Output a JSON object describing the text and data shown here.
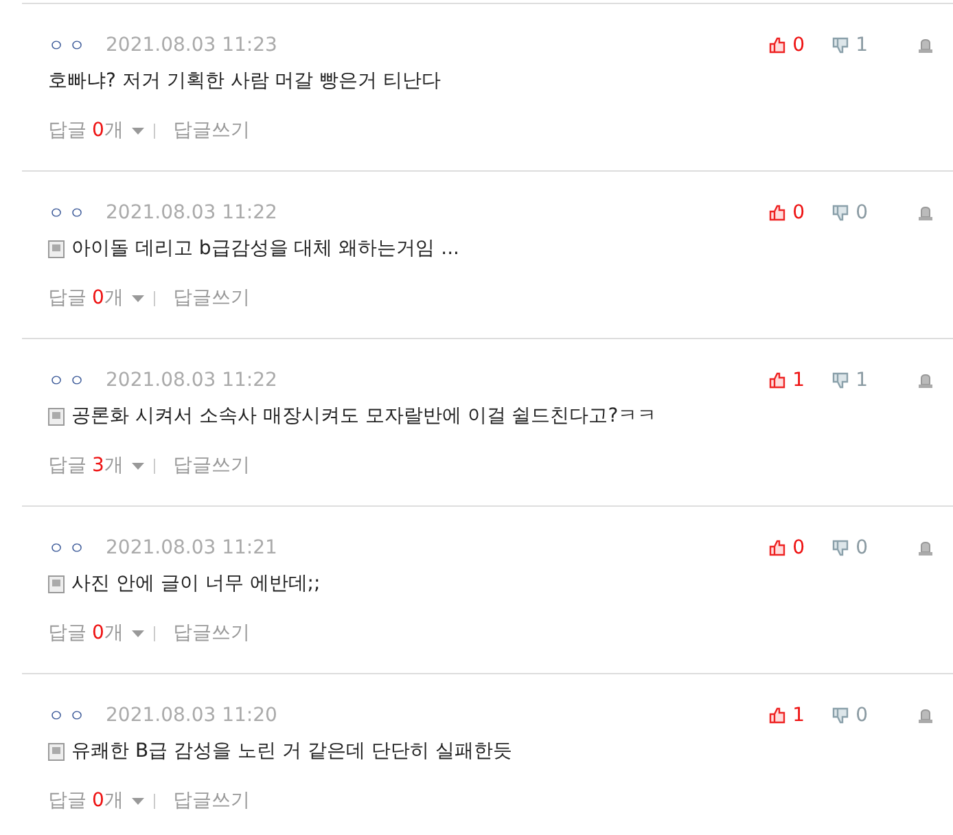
{
  "comments": [
    {
      "author": "ㅇㅇ",
      "date": "2021.08.03 11:23",
      "has_image": false,
      "text": "호빠냐? 저거 기획한 사람 머갈 빵은거 티난다",
      "likes": "0",
      "dislikes": "1",
      "reply_prefix": "답글",
      "reply_count": "0",
      "reply_suffix": "개",
      "write_reply": "답글쓰기"
    },
    {
      "author": "ㅇㅇ",
      "date": "2021.08.03 11:22",
      "has_image": true,
      "text": "아이돌 데리고 b급감성을 대체 왜하는거임 ...",
      "likes": "0",
      "dislikes": "0",
      "reply_prefix": "답글",
      "reply_count": "0",
      "reply_suffix": "개",
      "write_reply": "답글쓰기"
    },
    {
      "author": "ㅇㅇ",
      "date": "2021.08.03 11:22",
      "has_image": true,
      "text": "공론화 시켜서 소속사 매장시켜도 모자랄반에 이걸 쉴드친다고?ㅋㅋ",
      "likes": "1",
      "dislikes": "1",
      "reply_prefix": "답글",
      "reply_count": "3",
      "reply_suffix": "개",
      "write_reply": "답글쓰기"
    },
    {
      "author": "ㅇㅇ",
      "date": "2021.08.03 11:21",
      "has_image": true,
      "text": "사진 안에 글이 너무 에반데;;",
      "likes": "0",
      "dislikes": "0",
      "reply_prefix": "답글",
      "reply_count": "0",
      "reply_suffix": "개",
      "write_reply": "답글쓰기"
    },
    {
      "author": "ㅇㅇ",
      "date": "2021.08.03 11:20",
      "has_image": true,
      "text": "유쾌한 B급 감성을 노린 거 같은데 단단히 실패한듯",
      "likes": "1",
      "dislikes": "0",
      "reply_prefix": "답글",
      "reply_count": "0",
      "reply_suffix": "개",
      "write_reply": "답글쓰기"
    }
  ]
}
